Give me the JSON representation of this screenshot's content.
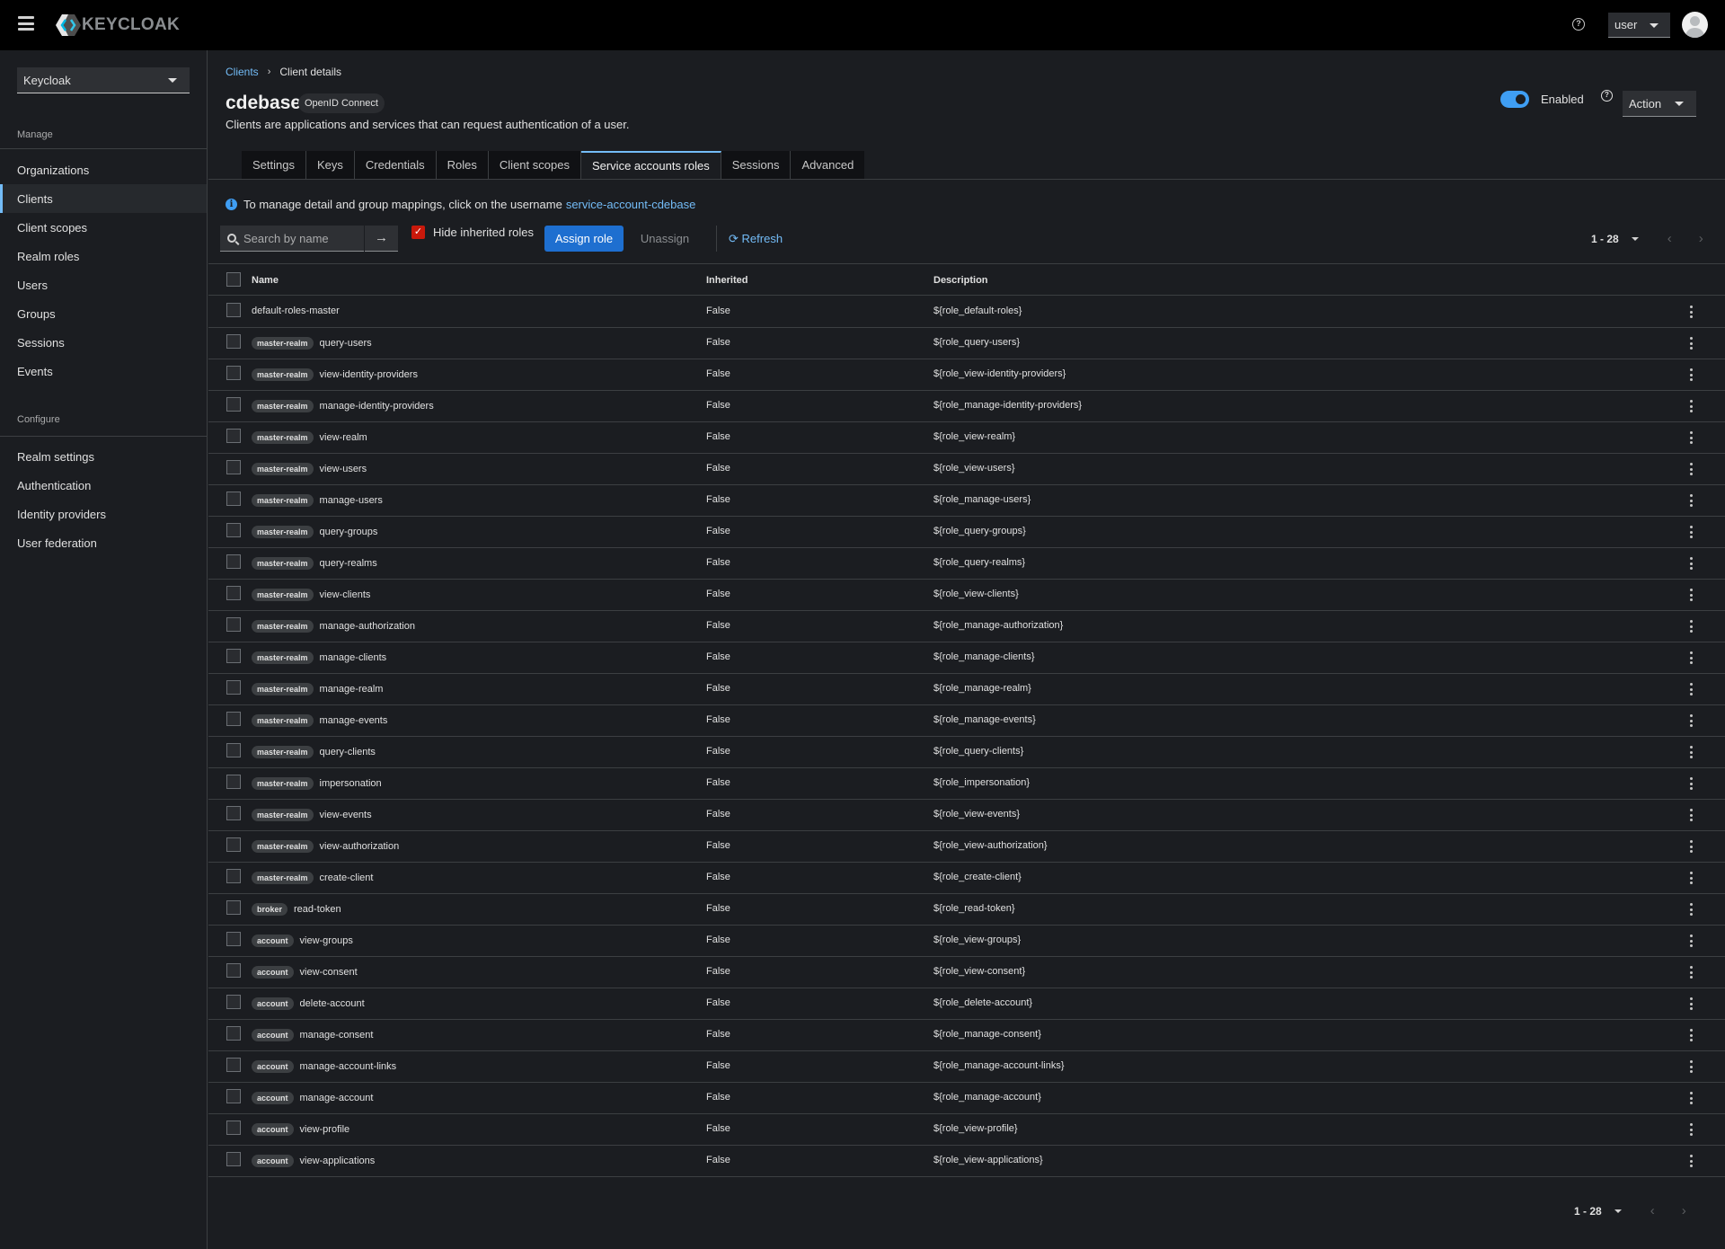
{
  "masthead": {
    "brand": "KEYCLOAK",
    "user_menu": "user"
  },
  "sidebar": {
    "realm": "Keycloak",
    "sections": [
      {
        "title": "Manage",
        "items": [
          {
            "label": "Organizations",
            "active": false
          },
          {
            "label": "Clients",
            "active": true
          },
          {
            "label": "Client scopes",
            "active": false
          },
          {
            "label": "Realm roles",
            "active": false
          },
          {
            "label": "Users",
            "active": false
          },
          {
            "label": "Groups",
            "active": false
          },
          {
            "label": "Sessions",
            "active": false
          },
          {
            "label": "Events",
            "active": false
          }
        ]
      },
      {
        "title": "Configure",
        "items": [
          {
            "label": "Realm settings",
            "active": false
          },
          {
            "label": "Authentication",
            "active": false
          },
          {
            "label": "Identity providers",
            "active": false
          },
          {
            "label": "User federation",
            "active": false
          }
        ]
      }
    ]
  },
  "breadcrumb": {
    "parent": "Clients",
    "current": "Client details",
    "separator": "›"
  },
  "header": {
    "title": "cdebase",
    "protocol_badge": "OpenID Connect",
    "description": "Clients are applications and services that can request authentication of a user.",
    "enabled_label": "Enabled",
    "enabled": true,
    "action_label": "Action"
  },
  "tabs": [
    {
      "label": "Settings",
      "active": false
    },
    {
      "label": "Keys",
      "active": false
    },
    {
      "label": "Credentials",
      "active": false
    },
    {
      "label": "Roles",
      "active": false
    },
    {
      "label": "Client scopes",
      "active": false
    },
    {
      "label": "Service accounts roles",
      "active": true
    },
    {
      "label": "Sessions",
      "active": false
    },
    {
      "label": "Advanced",
      "active": false
    }
  ],
  "info": {
    "text": "To manage detail and group mappings, click on the username",
    "link": "service-account-cdebase"
  },
  "toolbar": {
    "search_placeholder": "Search by name",
    "hide_inherited_label": "Hide inherited roles",
    "hide_inherited_checked": true,
    "assign_label": "Assign role",
    "unassign_label": "Unassign",
    "refresh_label": "Refresh"
  },
  "pagination": {
    "range": "1 - 28"
  },
  "table": {
    "columns": [
      "Name",
      "Inherited",
      "Description"
    ],
    "rows": [
      {
        "client": "",
        "name": "default-roles-master",
        "inherited": "False",
        "description": "${role_default-roles}"
      },
      {
        "client": "master-realm",
        "name": "query-users",
        "inherited": "False",
        "description": "${role_query-users}"
      },
      {
        "client": "master-realm",
        "name": "view-identity-providers",
        "inherited": "False",
        "description": "${role_view-identity-providers}"
      },
      {
        "client": "master-realm",
        "name": "manage-identity-providers",
        "inherited": "False",
        "description": "${role_manage-identity-providers}"
      },
      {
        "client": "master-realm",
        "name": "view-realm",
        "inherited": "False",
        "description": "${role_view-realm}"
      },
      {
        "client": "master-realm",
        "name": "view-users",
        "inherited": "False",
        "description": "${role_view-users}"
      },
      {
        "client": "master-realm",
        "name": "manage-users",
        "inherited": "False",
        "description": "${role_manage-users}"
      },
      {
        "client": "master-realm",
        "name": "query-groups",
        "inherited": "False",
        "description": "${role_query-groups}"
      },
      {
        "client": "master-realm",
        "name": "query-realms",
        "inherited": "False",
        "description": "${role_query-realms}"
      },
      {
        "client": "master-realm",
        "name": "view-clients",
        "inherited": "False",
        "description": "${role_view-clients}"
      },
      {
        "client": "master-realm",
        "name": "manage-authorization",
        "inherited": "False",
        "description": "${role_manage-authorization}"
      },
      {
        "client": "master-realm",
        "name": "manage-clients",
        "inherited": "False",
        "description": "${role_manage-clients}"
      },
      {
        "client": "master-realm",
        "name": "manage-realm",
        "inherited": "False",
        "description": "${role_manage-realm}"
      },
      {
        "client": "master-realm",
        "name": "manage-events",
        "inherited": "False",
        "description": "${role_manage-events}"
      },
      {
        "client": "master-realm",
        "name": "query-clients",
        "inherited": "False",
        "description": "${role_query-clients}"
      },
      {
        "client": "master-realm",
        "name": "impersonation",
        "inherited": "False",
        "description": "${role_impersonation}"
      },
      {
        "client": "master-realm",
        "name": "view-events",
        "inherited": "False",
        "description": "${role_view-events}"
      },
      {
        "client": "master-realm",
        "name": "view-authorization",
        "inherited": "False",
        "description": "${role_view-authorization}"
      },
      {
        "client": "master-realm",
        "name": "create-client",
        "inherited": "False",
        "description": "${role_create-client}"
      },
      {
        "client": "broker",
        "name": "read-token",
        "inherited": "False",
        "description": "${role_read-token}"
      },
      {
        "client": "account",
        "name": "view-groups",
        "inherited": "False",
        "description": "${role_view-groups}"
      },
      {
        "client": "account",
        "name": "view-consent",
        "inherited": "False",
        "description": "${role_view-consent}"
      },
      {
        "client": "account",
        "name": "delete-account",
        "inherited": "False",
        "description": "${role_delete-account}"
      },
      {
        "client": "account",
        "name": "manage-consent",
        "inherited": "False",
        "description": "${role_manage-consent}"
      },
      {
        "client": "account",
        "name": "manage-account-links",
        "inherited": "False",
        "description": "${role_manage-account-links}"
      },
      {
        "client": "account",
        "name": "manage-account",
        "inherited": "False",
        "description": "${role_manage-account}"
      },
      {
        "client": "account",
        "name": "view-profile",
        "inherited": "False",
        "description": "${role_view-profile}"
      },
      {
        "client": "account",
        "name": "view-applications",
        "inherited": "False",
        "description": "${role_view-applications}"
      }
    ]
  },
  "colors": {
    "accent": "#73bcf7",
    "primary_button": "#1e6fd0",
    "toggle_on": "#3f9ef3",
    "checkbox_checked": "#c9190b",
    "background": "#1b1d21",
    "masthead": "#000000"
  }
}
